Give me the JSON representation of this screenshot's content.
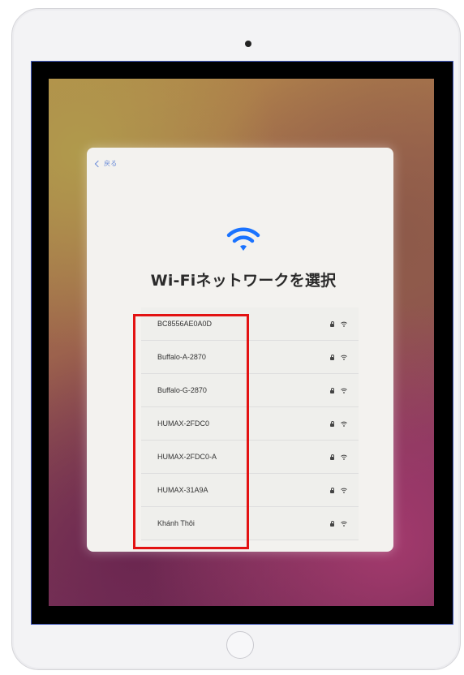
{
  "device": {
    "name": "iPad",
    "frame_color": "#f3f3f5",
    "screen_bezel_color": "#000000"
  },
  "setup_screen": {
    "back_label": "戻る",
    "header_icon": "wifi-icon",
    "title": "Wi-Fiネットワークを選択"
  },
  "networks": [
    {
      "name": "BC8556AE0A0D",
      "secured": true,
      "icon": "wifi-icon"
    },
    {
      "name": "Buffalo-A-2870",
      "secured": true,
      "icon": "wifi-icon"
    },
    {
      "name": "Buffalo-G-2870",
      "secured": true,
      "icon": "wifi-icon"
    },
    {
      "name": "HUMAX-2FDC0",
      "secured": true,
      "icon": "wifi-icon"
    },
    {
      "name": "HUMAX-2FDC0-A",
      "secured": true,
      "icon": "wifi-icon"
    },
    {
      "name": "HUMAX-31A9A",
      "secured": true,
      "icon": "wifi-icon"
    },
    {
      "name": "Khánh Thôi",
      "secured": true,
      "icon": "wifi-icon"
    }
  ],
  "annotation": {
    "highlight_color": "#e31212",
    "target": "network-list"
  },
  "colors": {
    "accent": "#1a73ff",
    "panel_bg": "#f3f2ef",
    "text": "#2b2b2b"
  }
}
